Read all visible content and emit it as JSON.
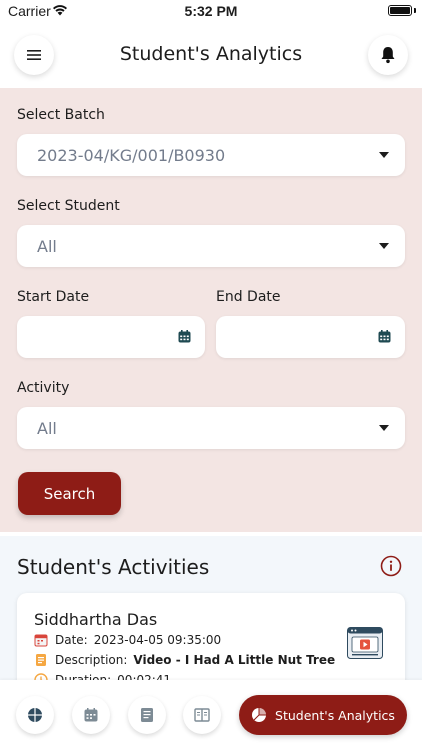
{
  "status_bar": {
    "carrier": "Carrier",
    "time": "5:32 PM"
  },
  "header": {
    "title": "Student's Analytics"
  },
  "filters": {
    "batch": {
      "label": "Select Batch",
      "value": "2023-04/KG/001/B0930"
    },
    "student": {
      "label": "Select Student",
      "value": "All"
    },
    "start_date": {
      "label": "Start Date",
      "value": ""
    },
    "end_date": {
      "label": "End Date",
      "value": ""
    },
    "activity": {
      "label": "Activity",
      "value": "All"
    },
    "search_label": "Search"
  },
  "activities": {
    "title": "Student's Activities",
    "items": [
      {
        "name": "Siddhartha Das",
        "date_label": "Date:",
        "date": "2023-04-05 09:35:00",
        "description_label": "Description:",
        "description": "Video - I Had A Little Nut Tree",
        "duration_label": "Duration:",
        "duration": "00:02:41"
      }
    ]
  },
  "bottom_nav": {
    "active_label": "Student's Analytics"
  },
  "colors": {
    "accent": "#8e1c16",
    "filter_bg": "#f3e5e3",
    "section_bg": "#f3f7fb"
  }
}
